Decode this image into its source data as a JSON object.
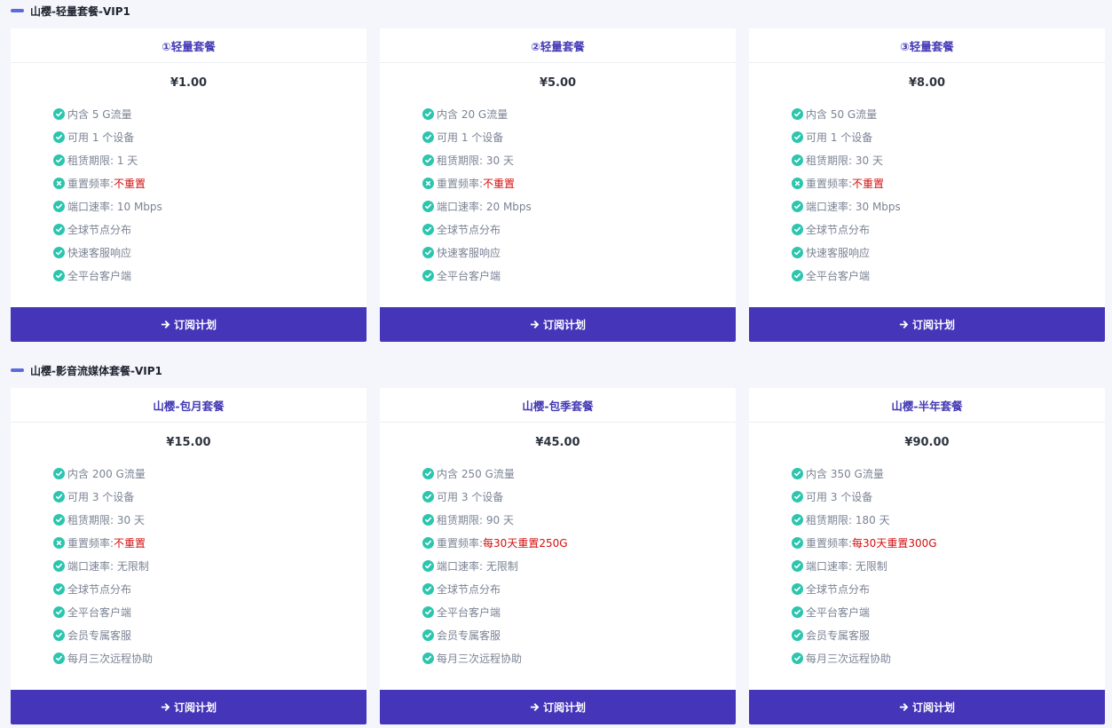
{
  "sections": [
    {
      "title": "山樱-轻量套餐-VIP1",
      "cards": [
        {
          "name": "①轻量套餐",
          "price": "¥1.00",
          "button": "订阅计划",
          "features": [
            {
              "icon": "check-icon",
              "label": "内含 5 G流量",
              "value": ""
            },
            {
              "icon": "check-icon",
              "label": "可用 1 个设备",
              "value": ""
            },
            {
              "icon": "check-icon",
              "label": "租赁期限: 1 天",
              "value": ""
            },
            {
              "icon": "cross-icon",
              "label": "重置频率: ",
              "value": "不重置"
            },
            {
              "icon": "check-icon",
              "label": "端口速率: 10 Mbps",
              "value": ""
            },
            {
              "icon": "check-icon",
              "label": "全球节点分布",
              "value": ""
            },
            {
              "icon": "check-icon",
              "label": "快速客服响应",
              "value": ""
            },
            {
              "icon": "check-icon",
              "label": "全平台客户端",
              "value": ""
            }
          ]
        },
        {
          "name": "②轻量套餐",
          "price": "¥5.00",
          "button": "订阅计划",
          "features": [
            {
              "icon": "check-icon",
              "label": "内含 20 G流量",
              "value": ""
            },
            {
              "icon": "check-icon",
              "label": "可用 1 个设备",
              "value": ""
            },
            {
              "icon": "check-icon",
              "label": "租赁期限: 30 天",
              "value": ""
            },
            {
              "icon": "cross-icon",
              "label": "重置频率: ",
              "value": "不重置"
            },
            {
              "icon": "check-icon",
              "label": "端口速率: 20 Mbps",
              "value": ""
            },
            {
              "icon": "check-icon",
              "label": "全球节点分布",
              "value": ""
            },
            {
              "icon": "check-icon",
              "label": "快速客服响应",
              "value": ""
            },
            {
              "icon": "check-icon",
              "label": "全平台客户端",
              "value": ""
            }
          ]
        },
        {
          "name": "③轻量套餐",
          "price": "¥8.00",
          "button": "订阅计划",
          "features": [
            {
              "icon": "check-icon",
              "label": "内含 50 G流量",
              "value": ""
            },
            {
              "icon": "check-icon",
              "label": "可用 1 个设备",
              "value": ""
            },
            {
              "icon": "check-icon",
              "label": "租赁期限: 30 天",
              "value": ""
            },
            {
              "icon": "cross-icon",
              "label": "重置频率: ",
              "value": "不重置"
            },
            {
              "icon": "check-icon",
              "label": "端口速率: 30 Mbps",
              "value": ""
            },
            {
              "icon": "check-icon",
              "label": "全球节点分布",
              "value": ""
            },
            {
              "icon": "check-icon",
              "label": "快速客服响应",
              "value": ""
            },
            {
              "icon": "check-icon",
              "label": "全平台客户端",
              "value": ""
            }
          ]
        }
      ]
    },
    {
      "title": "山樱-影音流媒体套餐-VIP1",
      "cards": [
        {
          "name": "山樱-包月套餐",
          "price": "¥15.00",
          "button": "订阅计划",
          "features": [
            {
              "icon": "check-icon",
              "label": "内含 200 G流量",
              "value": ""
            },
            {
              "icon": "check-icon",
              "label": "可用 3 个设备",
              "value": ""
            },
            {
              "icon": "check-icon",
              "label": "租赁期限: 30 天",
              "value": ""
            },
            {
              "icon": "cross-icon",
              "label": "重置频率: ",
              "value": "不重置"
            },
            {
              "icon": "check-icon",
              "label": "端口速率: 无限制",
              "value": ""
            },
            {
              "icon": "check-icon",
              "label": "全球节点分布",
              "value": ""
            },
            {
              "icon": "check-icon",
              "label": "全平台客户端",
              "value": ""
            },
            {
              "icon": "check-icon",
              "label": "会员专属客服",
              "value": ""
            },
            {
              "icon": "check-icon",
              "label": "每月三次远程协助",
              "value": ""
            }
          ]
        },
        {
          "name": "山樱-包季套餐",
          "price": "¥45.00",
          "button": "订阅计划",
          "features": [
            {
              "icon": "check-icon",
              "label": "内含 250 G流量",
              "value": ""
            },
            {
              "icon": "check-icon",
              "label": "可用 3 个设备",
              "value": ""
            },
            {
              "icon": "check-icon",
              "label": "租赁期限: 90 天",
              "value": ""
            },
            {
              "icon": "check-icon",
              "label": "重置频率: ",
              "value": "每30天重置250G"
            },
            {
              "icon": "check-icon",
              "label": "端口速率: 无限制",
              "value": ""
            },
            {
              "icon": "check-icon",
              "label": "全球节点分布",
              "value": ""
            },
            {
              "icon": "check-icon",
              "label": "全平台客户端",
              "value": ""
            },
            {
              "icon": "check-icon",
              "label": "会员专属客服",
              "value": ""
            },
            {
              "icon": "check-icon",
              "label": "每月三次远程协助",
              "value": ""
            }
          ]
        },
        {
          "name": "山樱-半年套餐",
          "price": "¥90.00",
          "button": "订阅计划",
          "features": [
            {
              "icon": "check-icon",
              "label": "内含 350 G流量",
              "value": ""
            },
            {
              "icon": "check-icon",
              "label": "可用 3 个设备",
              "value": ""
            },
            {
              "icon": "check-icon",
              "label": "租赁期限: 180 天",
              "value": ""
            },
            {
              "icon": "check-icon",
              "label": "重置频率: ",
              "value": "每30天重置300G"
            },
            {
              "icon": "check-icon",
              "label": "端口速率: 无限制",
              "value": ""
            },
            {
              "icon": "check-icon",
              "label": "全球节点分布",
              "value": ""
            },
            {
              "icon": "check-icon",
              "label": "全平台客户端",
              "value": ""
            },
            {
              "icon": "check-icon",
              "label": "会员专属客服",
              "value": ""
            },
            {
              "icon": "check-icon",
              "label": "每月三次远程协助",
              "value": ""
            }
          ]
        }
      ]
    }
  ],
  "colors": {
    "accent": "#4435b9",
    "plan_name": "#453bb5",
    "icon": "#2cc5ae",
    "highlight": "#d40e0e",
    "section_bar": "#5b6bdb"
  }
}
